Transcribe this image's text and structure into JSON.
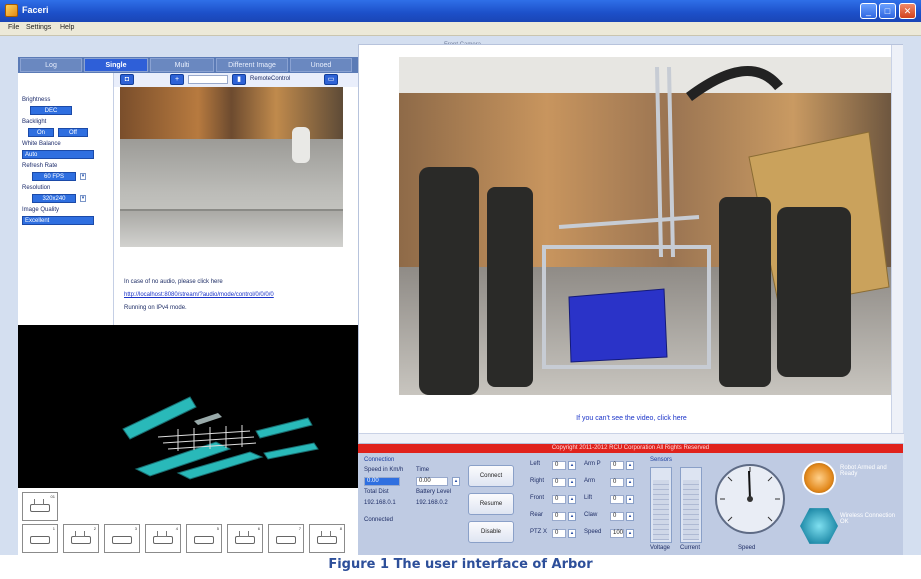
{
  "window": {
    "title": "Faceri",
    "colors": {
      "titlebar": "#1c4fc8",
      "accent": "#2e5fd8",
      "alert": "#e0221c"
    }
  },
  "menu": [
    "File",
    "Settings",
    "Help"
  ],
  "tabs": [
    {
      "label": "Log",
      "active": false
    },
    {
      "label": "Single",
      "active": true
    },
    {
      "label": "Multi",
      "active": false
    },
    {
      "label": "Different Image",
      "active": false
    },
    {
      "label": "Unoed",
      "active": false
    }
  ],
  "settings": {
    "brightness_label": "Brightness",
    "brightness_value": "DEC",
    "backlight_label": "Backlight",
    "backlight_on": "On",
    "backlight_off": "Off",
    "white_balance_label": "White Balance",
    "white_balance_value": "Auto",
    "refresh_rate_label": "Refresh Rate",
    "refresh_rate_value": "60 FPS",
    "resolution_label": "Resolution",
    "resolution_value": "320x240",
    "image_quality_label": "Image Quality",
    "image_quality_value": "Excellent"
  },
  "camera": {
    "zoom_value": "",
    "remote_control_label": "RemoteControl",
    "audio_text": "In case of no audio, please click here",
    "audio_link": "http://localhost:8080/stream/?audio/mode/control/0/0/0/0",
    "status_text": "Running on IPv4 mode."
  },
  "video": {
    "top_caption": "Front Camera",
    "cant_see_link": "If you can't see the video, click here"
  },
  "copyright": "Copyright 2011-2012 RCU Corporation All Rights Reserved",
  "controls": {
    "connection_title": "Connection",
    "speed_label": "Speed in Km/h",
    "time_label": "Time",
    "speed_value": "0.00",
    "time_value": "0.00",
    "distance_label": "Total Dist",
    "battery_label": "Battery Level",
    "ip_label": "IP Adr",
    "ip_value": "192.168.0.1",
    "port_value": "192.168.0.2",
    "connect_label": "Connect",
    "connected_text": "Connected",
    "buttons": [
      "Connect",
      "Resume",
      "Disable"
    ],
    "motor_rows": [
      {
        "label": "Left",
        "value": "0",
        "label2": "Arm P",
        "value2": "0"
      },
      {
        "label": "Right",
        "value": "0",
        "label2": "Arm",
        "value2": "0"
      },
      {
        "label": "Front",
        "value": "0",
        "label2": "Lift",
        "value2": "0"
      },
      {
        "label": "Rear",
        "value": "0",
        "label2": "Claw",
        "value2": "0"
      },
      {
        "label": "PTZ X",
        "value": "0",
        "label2": "Speed",
        "value2": "100"
      }
    ],
    "gauges_title": "Sensors",
    "gauge_labels": [
      "Voltage",
      "Current",
      "Speed"
    ],
    "status_orange_text": "Robot Armed and Ready",
    "status_blue_text": "Wireless Connection OK"
  },
  "figure_caption": "Figure 1 The user interface of Arbor"
}
